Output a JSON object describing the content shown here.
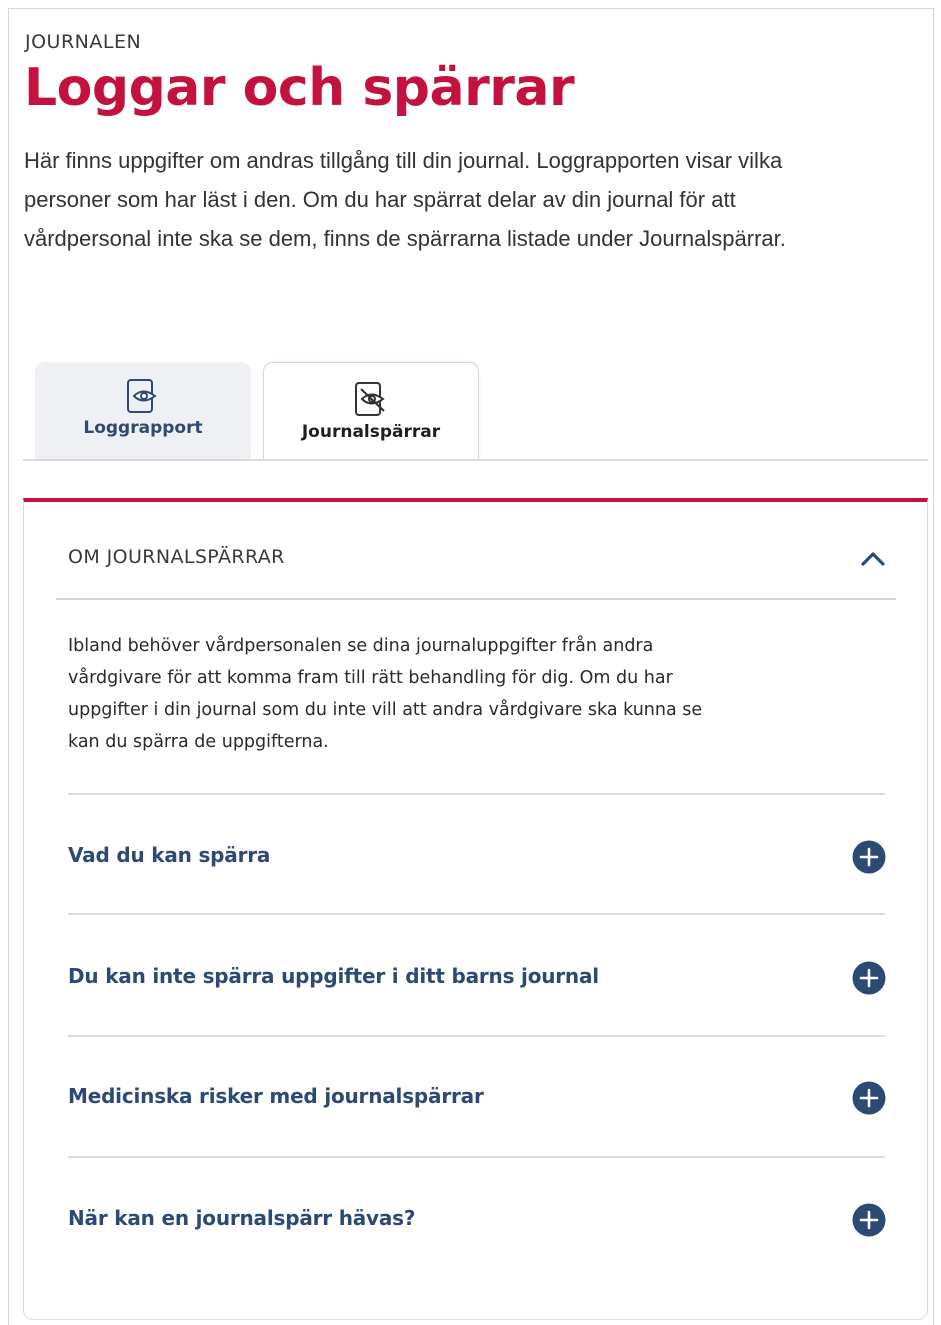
{
  "header": {
    "eyebrow": "JOURNALEN",
    "title": "Loggar och spärrar",
    "intro": "Här finns uppgifter om andras tillgång till din journal. Loggrapporten visar vilka personer som har läst i den. Om du har spärrat delar av din journal för att vårdpersonal inte ska se dem, finns de spärrarna listade under Journalspärrar."
  },
  "tabs": [
    {
      "label": "Loggrapport",
      "icon": "eye-document-icon",
      "active": false
    },
    {
      "label": "Journalspärrar",
      "icon": "eye-slash-document-icon",
      "active": true
    }
  ],
  "about": {
    "title": "OM JOURNALSPÄRRAR",
    "expanded": true,
    "body": "Ibland behöver vårdpersonalen se dina journaluppgifter från andra vårdgivare för att komma fram till rätt behandling för dig. Om du har uppgifter i din journal som du inte vill att andra vårdgivare ska kunna se kan du spärra de uppgifterna."
  },
  "accordion": [
    {
      "label": "Vad du kan spärra"
    },
    {
      "label": "Du kan inte spärra uppgifter i ditt barns journal"
    },
    {
      "label": "Medicinska risker med journalspärrar"
    },
    {
      "label": "När kan en journalspärr hävas?"
    }
  ],
  "colors": {
    "brand": "#c4123f",
    "link": "#2c4a73",
    "tab_inactive_bg": "#eef0f3"
  }
}
